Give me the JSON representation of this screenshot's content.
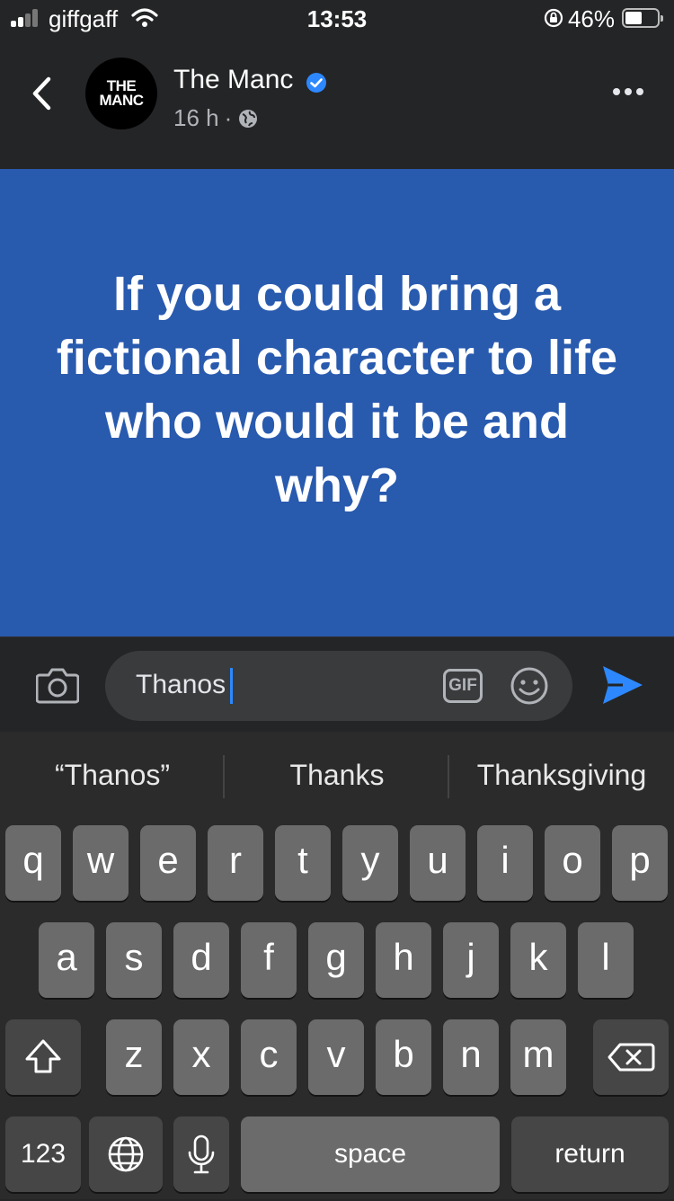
{
  "status_bar": {
    "carrier": "giffgaff",
    "time": "13:53",
    "battery": "46%"
  },
  "post": {
    "page_name": "The Manc",
    "avatar_text_1": "THE",
    "avatar_text_2": "MANC",
    "time_ago": "16 h",
    "separator": "·",
    "question": "If you could bring a fictional character to life who would it be and why?",
    "banner_color": "#285aae"
  },
  "composer": {
    "value": "Thanos",
    "gif_label": "GIF",
    "accent": "#2d88ff"
  },
  "keyboard": {
    "suggestions": [
      "“Thanos”",
      "Thanks",
      "Thanksgiving"
    ],
    "row1": [
      "q",
      "w",
      "e",
      "r",
      "t",
      "y",
      "u",
      "i",
      "o",
      "p"
    ],
    "row2": [
      "a",
      "s",
      "d",
      "f",
      "g",
      "h",
      "j",
      "k",
      "l"
    ],
    "row3": [
      "z",
      "x",
      "c",
      "v",
      "b",
      "n",
      "m"
    ],
    "numbers_label": "123",
    "space_label": "space",
    "return_label": "return"
  }
}
